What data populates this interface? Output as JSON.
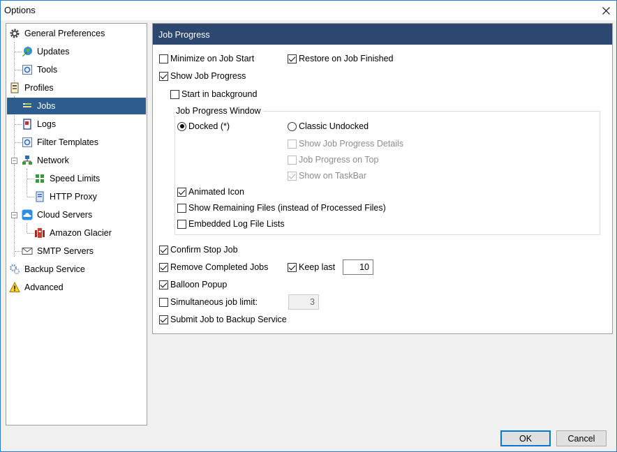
{
  "window": {
    "title": "Options"
  },
  "tree": {
    "items": [
      {
        "label": "General Preferences"
      },
      {
        "label": "Updates"
      },
      {
        "label": "Tools"
      },
      {
        "label": "Profiles"
      },
      {
        "label": "Jobs"
      },
      {
        "label": "Logs"
      },
      {
        "label": "Filter Templates"
      },
      {
        "label": "Network"
      },
      {
        "label": "Speed Limits"
      },
      {
        "label": "HTTP Proxy"
      },
      {
        "label": "Cloud Servers"
      },
      {
        "label": "Amazon Glacier"
      },
      {
        "label": "SMTP Servers"
      },
      {
        "label": "Backup Service"
      },
      {
        "label": "Advanced"
      }
    ],
    "selected": "Jobs"
  },
  "panel": {
    "header": "Job Progress",
    "minimize_on_job_start": {
      "label": "Minimize on Job Start",
      "checked": false
    },
    "restore_on_job_finished": {
      "label": "Restore on Job Finished",
      "checked": true
    },
    "show_job_progress": {
      "label": "Show Job Progress",
      "checked": true
    },
    "start_in_background": {
      "label": "Start in background",
      "checked": false
    },
    "group_title": "Job Progress Window",
    "docked": {
      "label": "Docked (*)",
      "selected": true
    },
    "classic_undocked": {
      "label": "Classic Undocked",
      "selected": false
    },
    "show_job_progress_details": {
      "label": "Show Job Progress Details",
      "checked": false,
      "disabled": true
    },
    "job_progress_on_top": {
      "label": "Job Progress on Top",
      "checked": false,
      "disabled": true
    },
    "show_on_taskbar": {
      "label": "Show on TaskBar",
      "checked": true,
      "disabled": true
    },
    "animated_icon": {
      "label": "Animated Icon",
      "checked": true
    },
    "show_remaining_files": {
      "label": "Show Remaining Files (instead of Processed Files)",
      "checked": false
    },
    "embedded_log_file_lists": {
      "label": "Embedded Log File Lists",
      "checked": false
    },
    "confirm_stop_job": {
      "label": "Confirm Stop Job",
      "checked": true
    },
    "remove_completed_jobs": {
      "label": "Remove Completed Jobs",
      "checked": true
    },
    "keep_last": {
      "label": "Keep last",
      "checked": true,
      "value": "10"
    },
    "balloon_popup": {
      "label": "Balloon Popup",
      "checked": true
    },
    "simultaneous_job_limit": {
      "label": "Simultaneous job limit:",
      "checked": false,
      "value": "3"
    },
    "submit_job_to_backup_service": {
      "label": "Submit Job to Backup Service",
      "checked": true
    }
  },
  "buttons": {
    "ok": "OK",
    "cancel": "Cancel"
  },
  "colors": {
    "header_bg": "#2c4770",
    "selected_bg": "#2d5d8f",
    "default_button_border": "#0078d7"
  }
}
